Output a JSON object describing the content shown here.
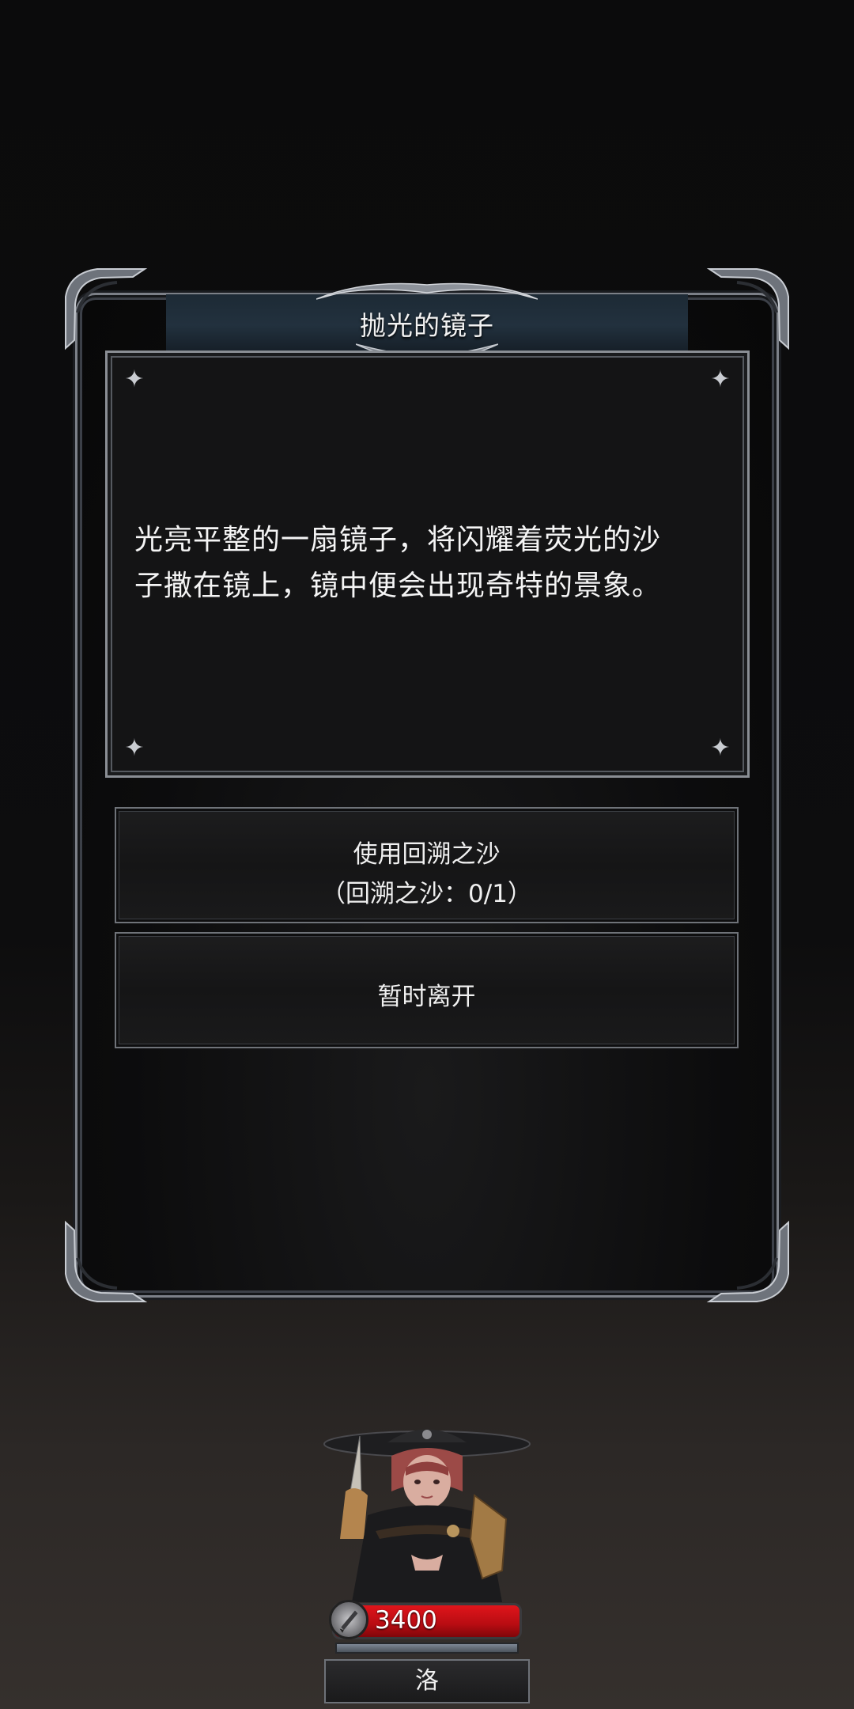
{
  "dialog": {
    "title": "抛光的镜子",
    "description_line1": "光亮平整的一扇镜子，将闪耀着荧光的沙",
    "description_line2": "子撒在镜上，镜中便会出现奇特的景象。",
    "options": [
      {
        "label": "使用回溯之沙",
        "sublabel": "（回溯之沙：0/1）"
      },
      {
        "label": "暂时离开"
      }
    ]
  },
  "character": {
    "hp": "3400",
    "name": "洛",
    "icon": "sword-icon"
  },
  "colors": {
    "hp_bar": "#d1111a",
    "title_bar": "#22313e",
    "frame": "#7c8088"
  }
}
